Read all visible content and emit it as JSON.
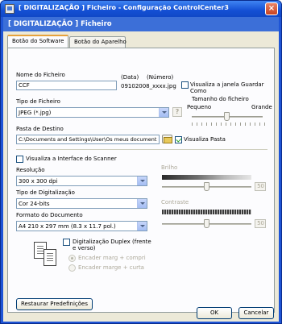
{
  "window": {
    "title": "[ DIGITALIZAÇÃO ]  Ficheiro - Configuração ControlCenter3",
    "banner": "[ DIGITALIZAÇÃO ]  Ficheiro",
    "close_glyph": "×"
  },
  "tabs": [
    {
      "label": "Botão do Software",
      "active": true
    },
    {
      "label": "Botão do Aparelho",
      "active": false
    }
  ],
  "file": {
    "name_label": "Nome do Ficheiro",
    "name_value": "CCF",
    "date_label": "(Data)",
    "number_label": "(Número)",
    "generated_name": "09102008_xxxx.jpg",
    "show_save_as_label": "Visualiza a janela Guardar Como",
    "show_save_as_checked": false
  },
  "file_type": {
    "label": "Tipo de Ficheiro",
    "value": "JPEG (*.jpg)",
    "help_glyph": "?"
  },
  "file_size": {
    "label": "Tamanho do ficheiro",
    "min_label": "Pequeno",
    "max_label": "Grande",
    "level": 0.5
  },
  "destination": {
    "label": "Pasta de Destino",
    "value": "C:\\Documents and Settings\\User\\Os meus document",
    "show_folder_label": "Visualiza Pasta",
    "show_folder_checked": true
  },
  "scanner_interface": {
    "label": "Visualiza a Interface do Scanner",
    "checked": false
  },
  "resolution": {
    "label": "Resolução",
    "value": "300 x 300 dpi"
  },
  "scan_type": {
    "label": "Tipo de Digitalização",
    "value": "Cor 24-bits"
  },
  "document_size": {
    "label": "Formato do Documento",
    "value": "A4 210 x 297 mm (8.3 x 11.7 pol.)"
  },
  "brightness": {
    "label": "Brilho",
    "value": "50",
    "level": 0.5
  },
  "contrast": {
    "label": "Contraste",
    "value": "50",
    "level": 0.5
  },
  "duplex": {
    "label": "Digitalização Duplex (frente e verso)",
    "checked": false,
    "options": [
      {
        "label": "Encader marg + compri",
        "selected": true
      },
      {
        "label": "Encader marge + curta",
        "selected": false
      }
    ]
  },
  "buttons": {
    "restore": "Restaurar Predefinições",
    "ok": "OK",
    "cancel": "Cancelar"
  },
  "icons": {
    "app": "app-window-icon",
    "close": "close-icon",
    "folder": "folder-browse-icon",
    "help": "help-icon",
    "duplex": "duplex-pages-icon"
  }
}
